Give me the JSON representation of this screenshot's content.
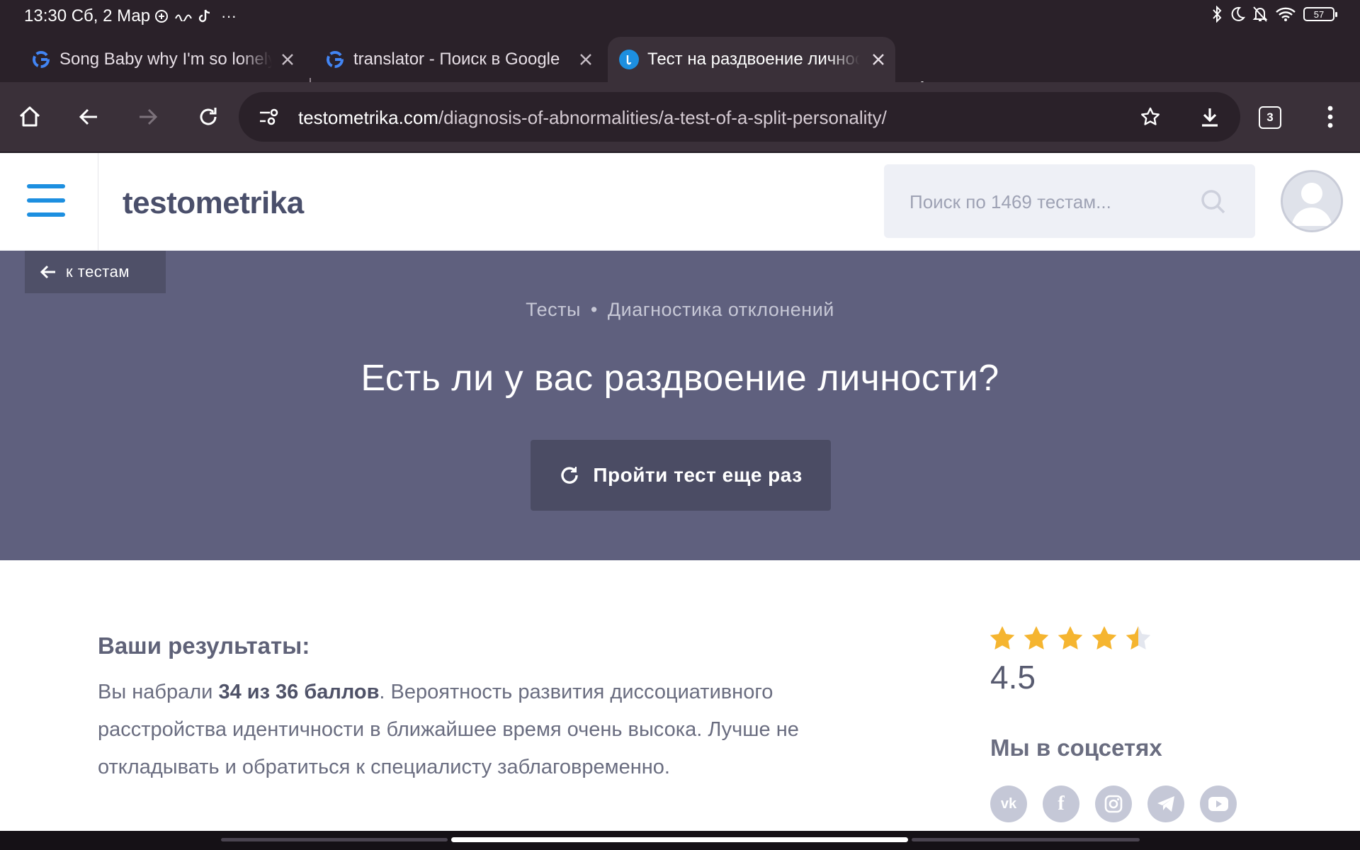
{
  "status_bar": {
    "time": "13:30 Сб, 2 Мар",
    "battery": "57",
    "notif_dots": "···"
  },
  "tabs": [
    {
      "title": "Song Baby why I'm so lonely",
      "favicon": "google-icon"
    },
    {
      "title": "translator - Поиск в Google",
      "favicon": "google-icon"
    },
    {
      "title": "Тест на раздвоение личности",
      "favicon": "testometrika-icon",
      "active": true
    }
  ],
  "toolbar": {
    "url_domain": "testometrika.com",
    "url_path": "/diagnosis-of-abnormalities/a-test-of-a-split-personality/",
    "tab_count": "3"
  },
  "site": {
    "logo": "testometrika",
    "search_placeholder": "Поиск по 1469 тестам..."
  },
  "hero": {
    "back_label": "к тестам",
    "breadcrumb": [
      "Тесты",
      "Диагностика отклонений"
    ],
    "breadcrumb_sep": "•",
    "title": "Есть ли у вас раздвоение личности?",
    "retake_label": "Пройти тест еще раз"
  },
  "results": {
    "heading": "Ваши результаты:",
    "text_before": "Вы набрали ",
    "score": "34 из 36 баллов",
    "text_after": ". Вероятность развития диссоциативного расстройства идентичности в ближайшее время очень высока. Лучше не откладывать и обратиться к специалисту заблаговременно."
  },
  "rating": {
    "value": "4.5",
    "stars": 4.5,
    "star_color": "#f5b530"
  },
  "social": {
    "heading": "Мы в соцсетях",
    "networks": [
      {
        "name": "vk-icon",
        "glyph": "vk"
      },
      {
        "name": "facebook-icon",
        "glyph": "f"
      },
      {
        "name": "instagram-icon",
        "glyph": ""
      },
      {
        "name": "telegram-icon",
        "glyph": ""
      },
      {
        "name": "youtube-icon",
        "glyph": ""
      }
    ]
  },
  "colors": {
    "accent_blue": "#1d8fe0",
    "hero_bg": "#5f607e",
    "browser_chrome": "#2a2129"
  }
}
